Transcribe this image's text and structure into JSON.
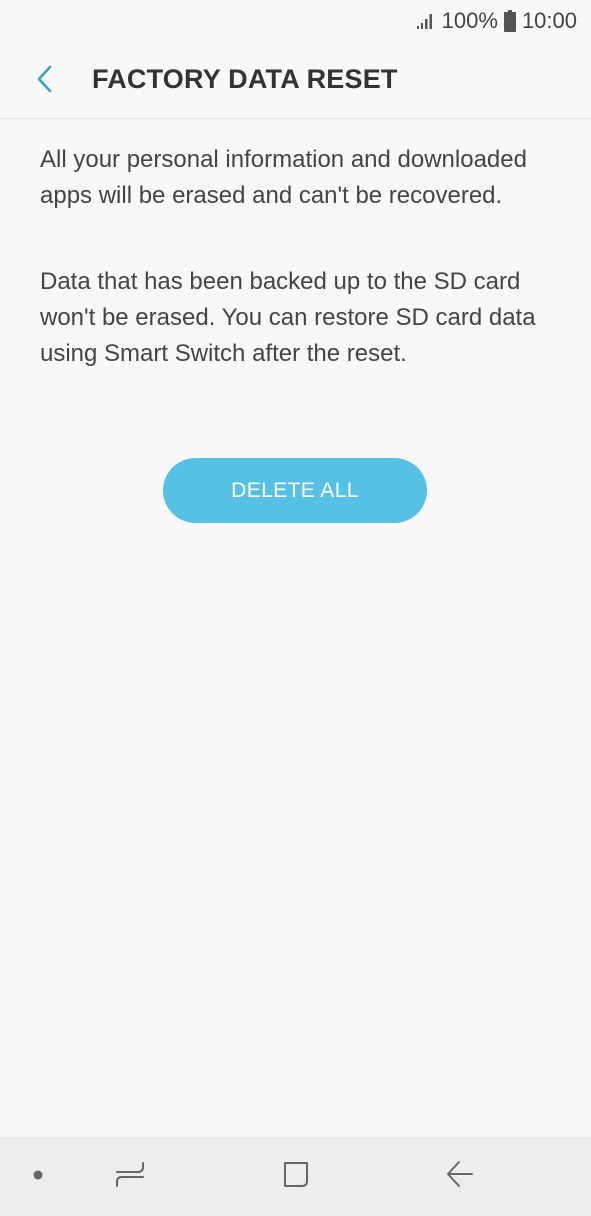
{
  "status_bar": {
    "battery_percent": "100%",
    "time": "10:00",
    "signal_icon": "signal-icon",
    "battery_icon": "battery-icon"
  },
  "header": {
    "title": "FACTORY DATA RESET",
    "back_icon": "chevron-left-icon"
  },
  "content": {
    "paragraph_1": "All your personal information and downloaded apps will be erased and can't be recovered.",
    "paragraph_2": "Data that has been backed up to the SD card won't be erased. You can restore SD card data using Smart Switch after the reset."
  },
  "actions": {
    "delete_all_label": "DELETE ALL"
  },
  "nav_bar": {
    "items": [
      "dot-icon",
      "recents-icon",
      "home-icon",
      "back-icon"
    ]
  },
  "colors": {
    "accent": "#57c1e5",
    "background": "#f8f8f8",
    "nav_background": "#ededed"
  }
}
